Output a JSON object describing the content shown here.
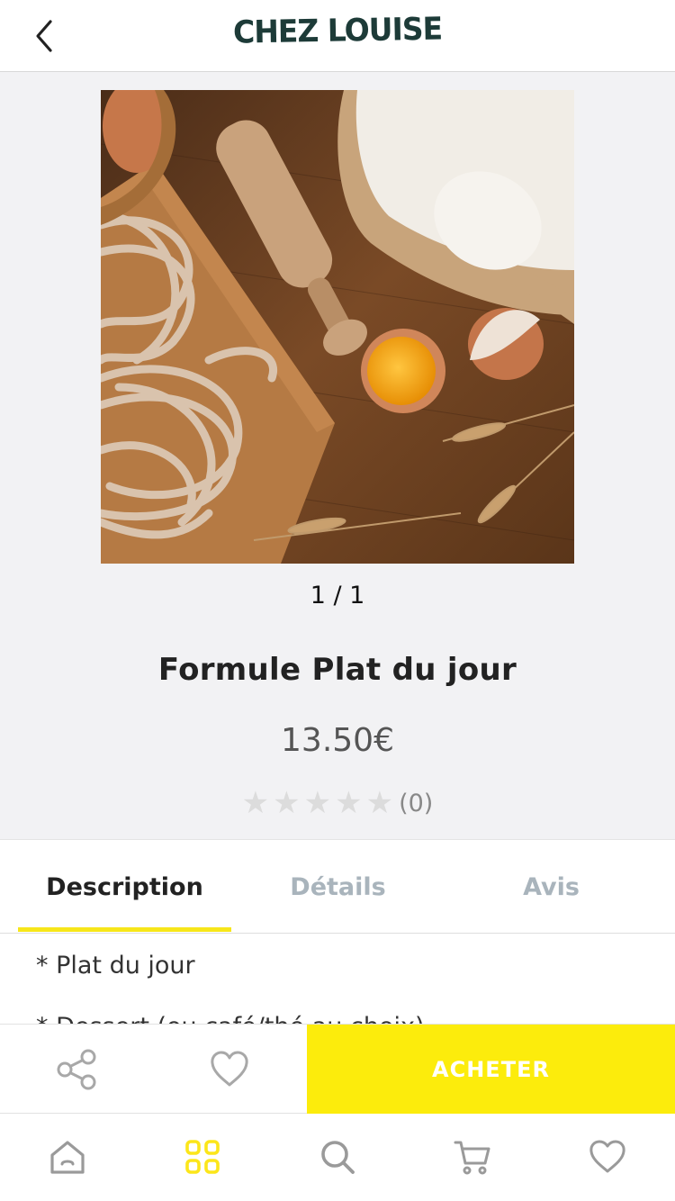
{
  "header": {
    "brand": "CHEZ LOUISE",
    "back_icon": "chevron-left-icon"
  },
  "product": {
    "pager": "1 / 1",
    "title": "Formule Plat du jour",
    "price": "13.50€",
    "rating_stars": 0,
    "rating_max": 5,
    "rating_count": "(0)"
  },
  "tabs": [
    {
      "label": "Description",
      "active": true
    },
    {
      "label": "Détails",
      "active": false
    },
    {
      "label": "Avis",
      "active": false
    }
  ],
  "description": {
    "line1": "* Plat du jour",
    "line2": "* Dessert (ou café/thé au choix)"
  },
  "actions": {
    "share_icon": "share-icon",
    "favorite_icon": "heart-icon",
    "buy_label": "ACHETER"
  },
  "bottom_nav": [
    {
      "icon": "home-icon",
      "active": false
    },
    {
      "icon": "grid-icon",
      "active": true
    },
    {
      "icon": "search-icon",
      "active": false
    },
    {
      "icon": "cart-icon",
      "active": false
    },
    {
      "icon": "heart-icon",
      "active": false
    }
  ],
  "colors": {
    "accent": "#fcec0c",
    "inactive_icon": "#9a9a9a",
    "inactive_tab": "#a9b4bc",
    "brand": "#1d3b38"
  }
}
